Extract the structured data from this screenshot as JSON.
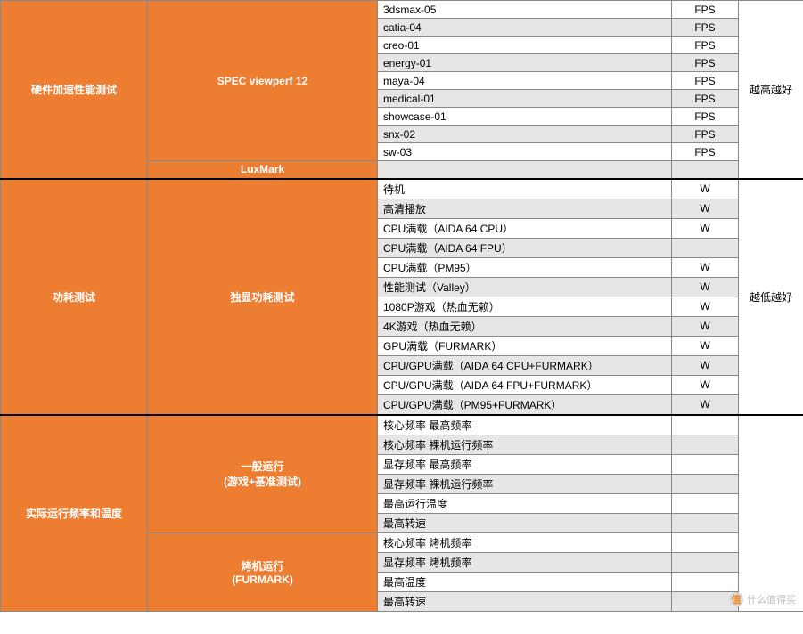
{
  "sections": [
    {
      "header": "硬件加速性能测试",
      "note": "越高越好",
      "groups": [
        {
          "label": "SPEC viewperf 12",
          "rows": [
            {
              "name": "3dsmax-05",
              "unit": "FPS",
              "shade": false
            },
            {
              "name": "catia-04",
              "unit": "FPS",
              "shade": true
            },
            {
              "name": "creo-01",
              "unit": "FPS",
              "shade": false
            },
            {
              "name": "energy-01",
              "unit": "FPS",
              "shade": true
            },
            {
              "name": "maya-04",
              "unit": "FPS",
              "shade": false
            },
            {
              "name": "medical-01",
              "unit": "FPS",
              "shade": true
            },
            {
              "name": "showcase-01",
              "unit": "FPS",
              "shade": false
            },
            {
              "name": "snx-02",
              "unit": "FPS",
              "shade": true
            },
            {
              "name": "sw-03",
              "unit": "FPS",
              "shade": false
            }
          ]
        },
        {
          "label": "LuxMark",
          "rows": [
            {
              "name": "",
              "unit": "",
              "shade": true
            }
          ]
        }
      ]
    },
    {
      "header": "功耗测试",
      "note": "越低越好",
      "groups": [
        {
          "label": "独显功耗测试",
          "rows": [
            {
              "name": "待机",
              "unit": "W",
              "shade": false
            },
            {
              "name": "高清播放",
              "unit": "W",
              "shade": true
            },
            {
              "name": "CPU满载（AIDA 64 CPU）",
              "unit": "W",
              "shade": false
            },
            {
              "name": "CPU满载（AIDA 64 FPU）",
              "unit": "",
              "shade": true
            },
            {
              "name": "CPU满载（PM95）",
              "unit": "W",
              "shade": false
            },
            {
              "name": "性能测试（Valley）",
              "unit": "W",
              "shade": true
            },
            {
              "name": "1080P游戏（热血无赖）",
              "unit": "W",
              "shade": false
            },
            {
              "name": "4K游戏（热血无赖）",
              "unit": "W",
              "shade": true
            },
            {
              "name": "GPU满载（FURMARK）",
              "unit": "W",
              "shade": false
            },
            {
              "name": "CPU/GPU满载（AIDA 64 CPU+FURMARK）",
              "unit": "W",
              "shade": true
            },
            {
              "name": "CPU/GPU满载（AIDA 64 FPU+FURMARK）",
              "unit": "W",
              "shade": false
            },
            {
              "name": "CPU/GPU满载（PM95+FURMARK）",
              "unit": "W",
              "shade": true
            }
          ]
        }
      ]
    },
    {
      "header": "实际运行频率和温度",
      "note": "",
      "groups": [
        {
          "label": "一般运行\n(游戏+基准测试)",
          "rows": [
            {
              "name": "核心频率 最高频率",
              "unit": "",
              "shade": false
            },
            {
              "name": "核心频率 裸机运行频率",
              "unit": "",
              "shade": true
            },
            {
              "name": "显存频率 最高频率",
              "unit": "",
              "shade": false
            },
            {
              "name": "显存频率 裸机运行频率",
              "unit": "",
              "shade": true
            },
            {
              "name": "最高运行温度",
              "unit": "",
              "shade": false
            },
            {
              "name": "最高转速",
              "unit": "",
              "shade": true
            }
          ]
        },
        {
          "label": "烤机运行\n(FURMARK)",
          "rows": [
            {
              "name": "核心频率 烤机频率",
              "unit": "",
              "shade": false
            },
            {
              "name": "显存频率 烤机频率",
              "unit": "",
              "shade": true
            },
            {
              "name": "最高温度",
              "unit": "",
              "shade": false
            },
            {
              "name": "最高转速",
              "unit": "",
              "shade": true
            }
          ]
        }
      ]
    }
  ],
  "watermark": {
    "symbol": "值",
    "text": "什么值得买"
  }
}
